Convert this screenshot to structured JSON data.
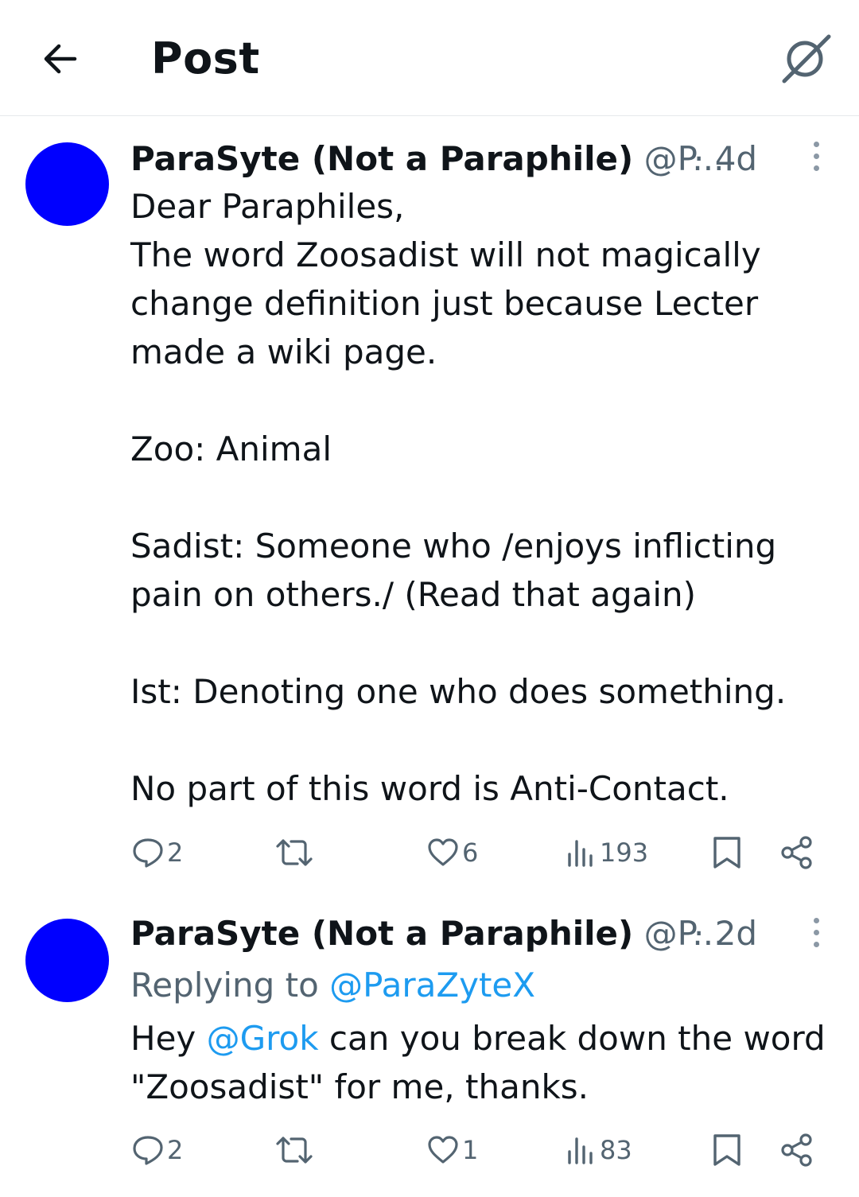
{
  "header": {
    "back_icon": "arrow-left-icon",
    "title": "Post",
    "grok_icon": "grok-icon"
  },
  "tweets": [
    {
      "author_name": "ParaSyte (Not a Paraphile)",
      "author_handle": "@P...",
      "time": "· 4d",
      "avatar_color": "#0000ff",
      "lines": [
        "Dear Paraphiles,",
        "The word Zoosadist will not magically",
        "change definition just because Lecter",
        "made a wiki page.",
        "",
        "Zoo: Animal",
        "",
        "Sadist: Someone who /enjoys inflicting",
        "pain on others./ (Read that again)",
        "",
        "Ist:  Denoting one who does something.",
        "",
        "No part of this word is Anti-Contact."
      ],
      "stats": {
        "replies": "2",
        "reposts": "",
        "likes": "6",
        "views": "193"
      }
    },
    {
      "author_name": "ParaSyte (Not a Paraphile)",
      "author_handle": "@P...",
      "time": "· 2d",
      "avatar_color": "#0000ff",
      "replying_label": "Replying to",
      "replying_handle": "@ParaZyteX",
      "text_before_mention": "Hey",
      "mention": "@Grok",
      "text_after_mention": "can you break down the word",
      "line2": "\"Zoosadist\" for me, thanks.",
      "stats": {
        "replies": "2",
        "reposts": "",
        "likes": "1",
        "views": "83"
      }
    }
  ],
  "colors": {
    "text": "#0f1419",
    "muted": "#536471",
    "link": "#1d9bf0",
    "divider": "#e6e9eb"
  }
}
